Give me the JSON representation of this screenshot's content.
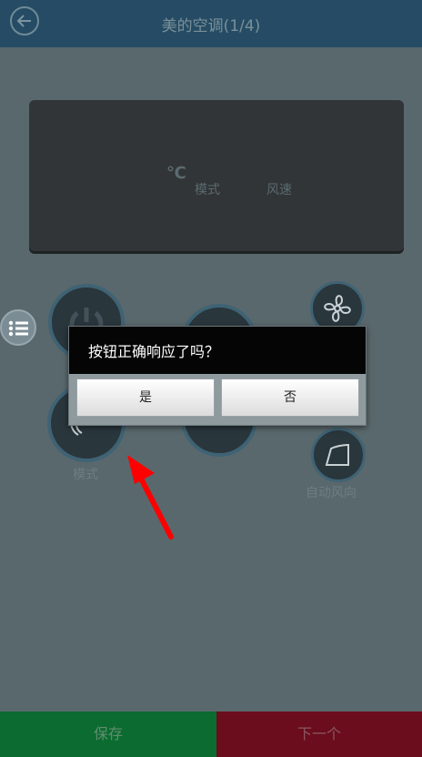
{
  "header": {
    "title": "美的空调(1/4)"
  },
  "display": {
    "temp_unit": "℃",
    "mode_label": "模式",
    "wind_label": "风速"
  },
  "controls": {
    "mode_label": "模式",
    "auto_wind_label": "自动风向"
  },
  "dialog": {
    "message": "按钮正确响应了吗？",
    "yes_label": "是",
    "no_label": "否"
  },
  "footer": {
    "save_label": "保存",
    "next_label": "下一个"
  },
  "annotation": {
    "arrow_color": "#ff0000"
  }
}
